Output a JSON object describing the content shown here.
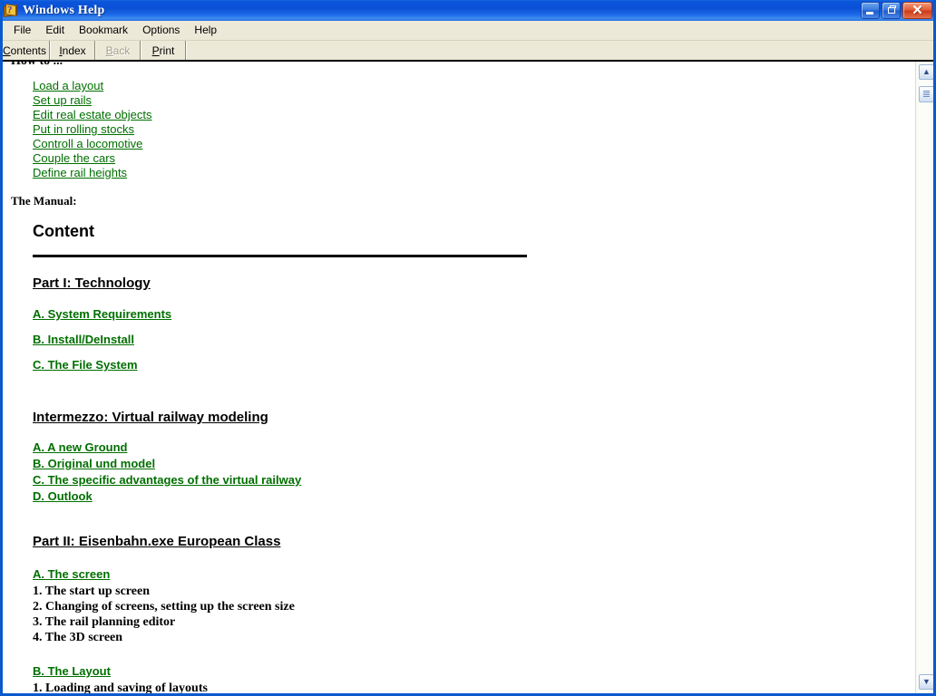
{
  "window": {
    "title": "Windows Help",
    "icon": "help-book-icon",
    "controls": {
      "minimize": "minimize-button",
      "restore": "restore-button",
      "close": "close-button"
    },
    "frame_color": "#0A59CE",
    "titlebar_color": "#0A50D6"
  },
  "menubar": {
    "items": [
      {
        "label": "File"
      },
      {
        "label": "Edit"
      },
      {
        "label": "Bookmark"
      },
      {
        "label": "Options"
      },
      {
        "label": "Help"
      }
    ]
  },
  "toolbar": {
    "buttons": [
      {
        "label": "Contents",
        "accel": "C",
        "enabled": true
      },
      {
        "label": "Index",
        "accel": "I",
        "enabled": true
      },
      {
        "label": "Back",
        "accel": "B",
        "enabled": false
      },
      {
        "label": "Print",
        "accel": "P",
        "enabled": true
      }
    ],
    "background": "#ECE9D8"
  },
  "document": {
    "link_color": "#006F00",
    "howto_heading": "How to ...",
    "howto_links": [
      "Load a layout ",
      "Set up rails",
      "Edit real estate objects",
      "Put in rolling stocks",
      "Controll a locomotive",
      "Couple the cars",
      "Define rail heights"
    ],
    "manual_label": "The Manual:",
    "content_title": "Content",
    "part1": {
      "heading": "Part I:   Technology",
      "links": [
        "A. System Requirements",
        "B. Install/DeInstall",
        "C. The File System"
      ]
    },
    "intermezzo": {
      "heading": "Intermezzo: Virtual railway modeling",
      "links": [
        "A. A new Ground",
        "B. Original und model",
        "C. The specific advantages of the virtual railway",
        "D. Outlook"
      ]
    },
    "part2": {
      "heading": "Part II:   Eisenbahn.exe European Class",
      "section_a": {
        "link": "A. The screen",
        "items": [
          "1. The start up screen",
          "2. Changing of screens, setting up the screen size",
          "3. The rail planning editor",
          "4. The 3D screen"
        ]
      },
      "section_b": {
        "link": "B. The Layout",
        "items": [
          "1. Loading and saving of layouts"
        ]
      }
    }
  },
  "scrollbar": {
    "up_arrow": "▲",
    "down_arrow": "▼"
  }
}
